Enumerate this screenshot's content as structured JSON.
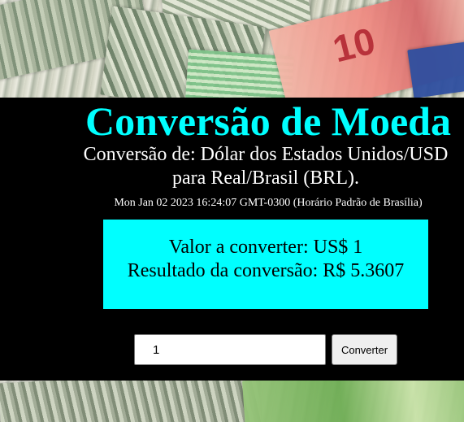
{
  "header": {
    "title": "Conversão de Moeda",
    "subtitle": "Conversão de: Dólar dos Estados Unidos/USD para Real/Brasil (BRL).",
    "timestamp": "Mon Jan 02 2023 16:24:07 GMT-0300 (Horário Padrão de Brasília)"
  },
  "result": {
    "value_line": "Valor a converter: US$ 1",
    "result_line": "Resultado da conversão: R$ 5.3607"
  },
  "form": {
    "amount_value": "1",
    "convert_label": "Converter"
  },
  "colors": {
    "title": "#00ffff",
    "result_box": "#00ffff",
    "panel": "#000000"
  }
}
